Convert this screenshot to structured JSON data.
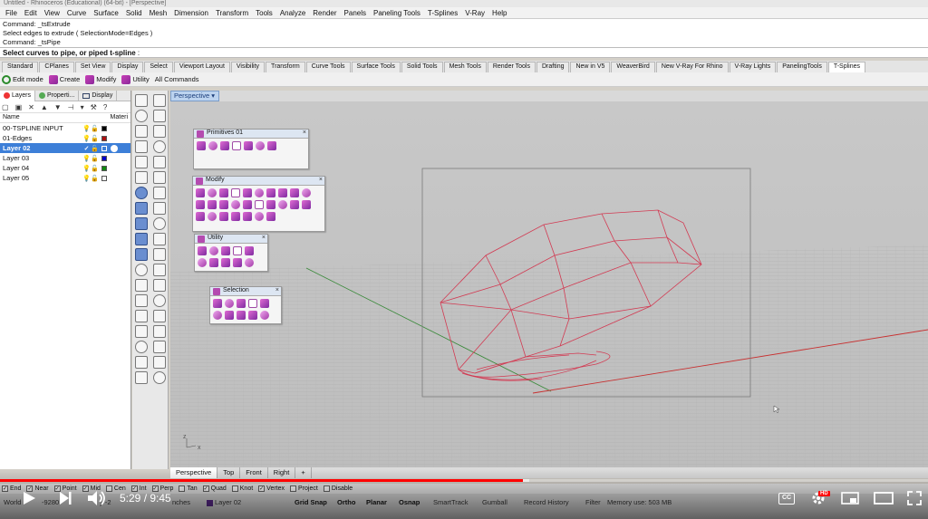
{
  "app": {
    "title": "Untitled - Rhinoceros (Educational) (64-bit) - [Perspective]"
  },
  "menu": [
    "File",
    "Edit",
    "View",
    "Curve",
    "Surface",
    "Solid",
    "Mesh",
    "Dimension",
    "Transform",
    "Tools",
    "Analyze",
    "Render",
    "Panels",
    "Paneling Tools",
    "T-Splines",
    "V-Ray",
    "Help"
  ],
  "command_history": [
    "Command: _tsExtrude",
    "Select edges to extrude ( SelectionMode=Edges )",
    "Command: _tsPipe"
  ],
  "command_prompt": "Select curves to pipe, or piped t-spline",
  "toolbar_tabs": [
    "Standard",
    "CPlanes",
    "Set View",
    "Display",
    "Select",
    "Viewport Layout",
    "Visibility",
    "Transform",
    "Curve Tools",
    "Surface Tools",
    "Solid Tools",
    "Mesh Tools",
    "Render Tools",
    "Drafting",
    "New in V5",
    "WeaverBird",
    "New V-Ray For Rhino",
    "V-Ray Lights",
    "PanelingTools",
    "T-Splines"
  ],
  "active_toolbar_tab": "T-Splines",
  "tsplines_toolbar": [
    "Edit mode",
    "Create",
    "Modify",
    "Utility",
    "All Commands"
  ],
  "panel": {
    "tabs": [
      "Layers",
      "Properti...",
      "Display"
    ],
    "columns": {
      "name": "Name",
      "material": "Materi"
    },
    "layers": [
      {
        "name": "00-TSPLINE INPUT",
        "color": "#000000",
        "current": false,
        "selected": false
      },
      {
        "name": "01-Edges",
        "color": "#aa1111",
        "current": false,
        "selected": false
      },
      {
        "name": "Layer 02",
        "color": "#3d7fd8",
        "current": true,
        "selected": true
      },
      {
        "name": "Layer 03",
        "color": "#0000cc",
        "current": false,
        "selected": false
      },
      {
        "name": "Layer 04",
        "color": "#118811",
        "current": false,
        "selected": false
      },
      {
        "name": "Layer 05",
        "color": "#ffffff",
        "current": false,
        "selected": false
      }
    ]
  },
  "viewport": {
    "name": "Perspective",
    "tabs": [
      "Perspective",
      "Top",
      "Front",
      "Right"
    ],
    "add_tab": "+",
    "active_tab": "Perspective",
    "axis_labels": {
      "z": "z",
      "x": "x"
    }
  },
  "palettes": {
    "primitives": {
      "title": "Primitives 01",
      "close": "×",
      "icon_count": 7
    },
    "modify": {
      "title": "Modify",
      "close": "×",
      "icon_count": 27
    },
    "utility": {
      "title": "Utility",
      "close": "×",
      "icon_count": 10
    },
    "selection": {
      "title": "Selection",
      "close": "×",
      "icon_count": 10
    }
  },
  "osnaps": [
    {
      "label": "End",
      "checked": true
    },
    {
      "label": "Near",
      "checked": true
    },
    {
      "label": "Point",
      "checked": true
    },
    {
      "label": "Mid",
      "checked": true
    },
    {
      "label": "Cen",
      "checked": false
    },
    {
      "label": "Int",
      "checked": true
    },
    {
      "label": "Perp",
      "checked": true
    },
    {
      "label": "Tan",
      "checked": false
    },
    {
      "label": "Quad",
      "checked": true
    },
    {
      "label": "Knot",
      "checked": false
    },
    {
      "label": "Vertex",
      "checked": true
    },
    {
      "label": "Project",
      "checked": false
    },
    {
      "label": "Disable",
      "checked": false
    }
  ],
  "status": {
    "world": "World",
    "coord_x": "-9280",
    "coord_y": "y  -2",
    "units": "nches",
    "layer": "Layer 02",
    "toggles": [
      "Grid Snap",
      "Ortho",
      "Planar",
      "Osnap",
      "SmartTrack",
      "Gumball",
      "Record History",
      "Filter",
      "Memory use: 503 MB"
    ],
    "bold_toggles": [
      "Grid Snap",
      "Ortho",
      "Planar",
      "Osnap"
    ]
  },
  "video": {
    "current_time": "5:29",
    "duration": "9:45",
    "separator": " / ",
    "played_fraction": 0.563,
    "buffered_fraction": 0.57,
    "hd_badge": "HD",
    "cc_label": "CC"
  },
  "colors": {
    "accent": "#3d7fd8",
    "wireframe": "#d23a52",
    "progress": "#ff0000",
    "tsplines_icon": "#b44bb0"
  }
}
